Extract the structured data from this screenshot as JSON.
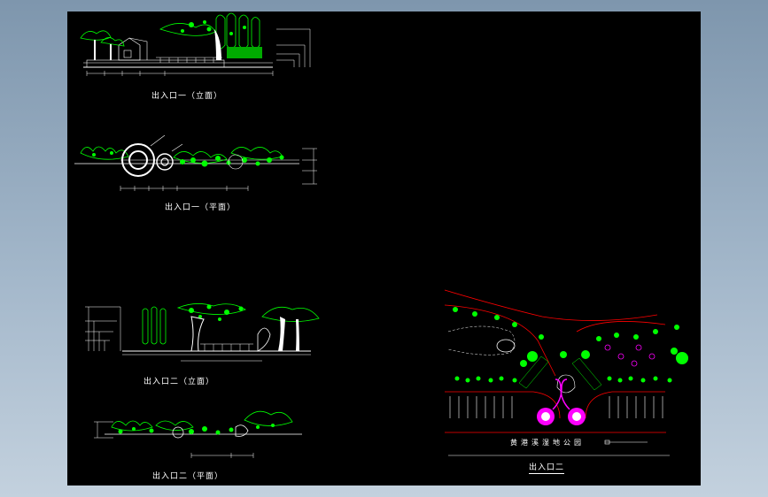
{
  "captions": {
    "elev1": "出入口一（立面）",
    "plan1": "出入口一（平面）",
    "elev2": "出入口二（立面）",
    "plan2": "出入口二（平面）",
    "site2": "出入口二"
  },
  "plaque_text": "黄港溪湿地公园",
  "colors": {
    "background": "#000000",
    "vegetation": "#00ff00",
    "linework": "#ffffff",
    "boundary": "#ff0000",
    "flowers": "#ff00ff"
  }
}
